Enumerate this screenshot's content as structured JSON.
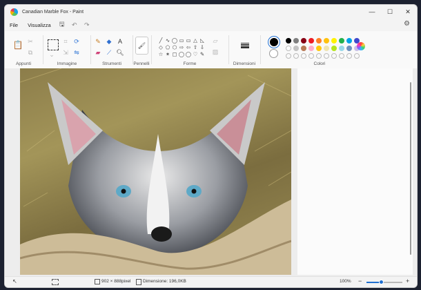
{
  "window": {
    "title": "Canadian Marble Fox - Paint",
    "controls": [
      "minimize-icon",
      "maximize-icon",
      "close-icon"
    ]
  },
  "menu": {
    "file": "File",
    "view": "Visualizza",
    "icons": [
      "save-icon",
      "undo-icon",
      "redo-icon",
      "settings-icon"
    ]
  },
  "ribbon": {
    "groups": {
      "clipboard": "Appunti",
      "image": "Immagine",
      "tools": "Strumenti",
      "brushes": "Pennelli",
      "shapes": "Forme",
      "size": "Dimensioni",
      "colors": "Colori"
    },
    "shapes_glyphs": [
      "╱",
      "∿",
      "◯",
      "▭",
      "▭",
      "△",
      "◺",
      "◇",
      "⬠",
      "⬡",
      "⇨",
      "⇦",
      "⇧",
      "⇩",
      "☆",
      "✶",
      "▢",
      "◯",
      "◯",
      "♡",
      "✎"
    ],
    "primary_color": "#000000",
    "secondary_color": "#ffffff",
    "palette_row1": [
      "#000000",
      "#7f7f7f",
      "#880015",
      "#ed1c24",
      "#ff7f27",
      "#ffc20e",
      "#fff200",
      "#22b14c",
      "#00a2e8",
      "#3f48cc"
    ],
    "palette_row2": [
      "#ffffff",
      "#c3c3c3",
      "#b97a57",
      "#ffaec9",
      "#ffc90e",
      "#efe4b0",
      "#b5e61d",
      "#99d9ea",
      "#7092be",
      "#c8bfe7"
    ],
    "palette_row3_empty": 10,
    "accent": "#1f6fd1"
  },
  "status": {
    "canvas_size": "902 × 888pixel",
    "file_size": "Dimensione: 196,0KB",
    "zoom": "100%",
    "zoom_level": 0.42,
    "zoom_minus": "−",
    "zoom_plus": "+"
  }
}
